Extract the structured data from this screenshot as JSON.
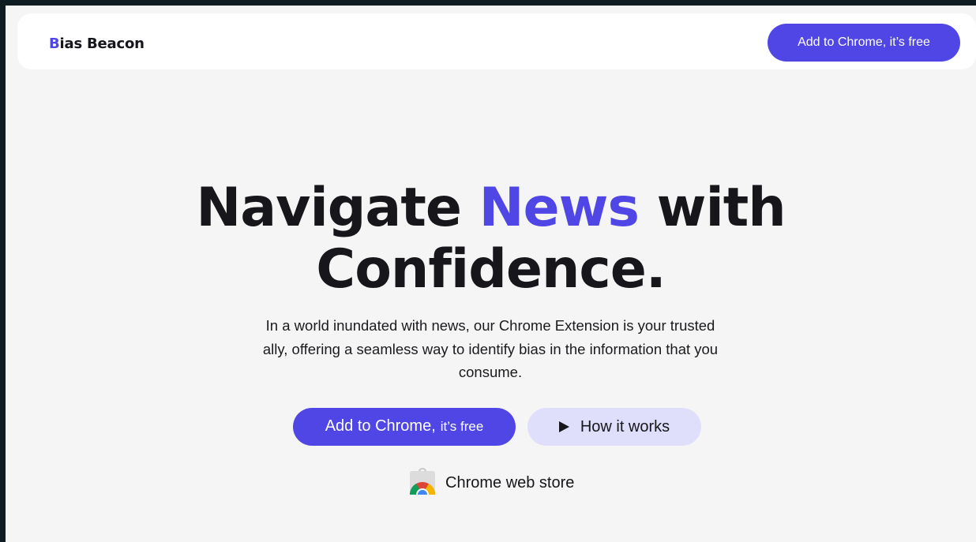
{
  "header": {
    "logo_initial": "B",
    "logo_rest": "ias Beacon",
    "cta_label": "Add to Chrome, it’s free"
  },
  "hero": {
    "title_part1": "Navigate ",
    "title_accent": "News",
    "title_part2": " with",
    "title_line2": "Confidence.",
    "subtitle": "In a world inundated with news, our Chrome Extension is your trusted ally, offering a seamless way to identify bias in the information that you consume.",
    "primary_button_main": "Add to Chrome,",
    "primary_button_small": "it’s free",
    "secondary_button_label": "How it works",
    "store_label": "Chrome web store"
  },
  "icons": {
    "play": "play-icon",
    "store": "chrome-web-store-icon"
  },
  "colors": {
    "accent": "#4f46e5",
    "secondary_button_bg": "#e0dffb",
    "page_bg": "#f5f5f5",
    "frame_bg": "#0f1c22"
  }
}
